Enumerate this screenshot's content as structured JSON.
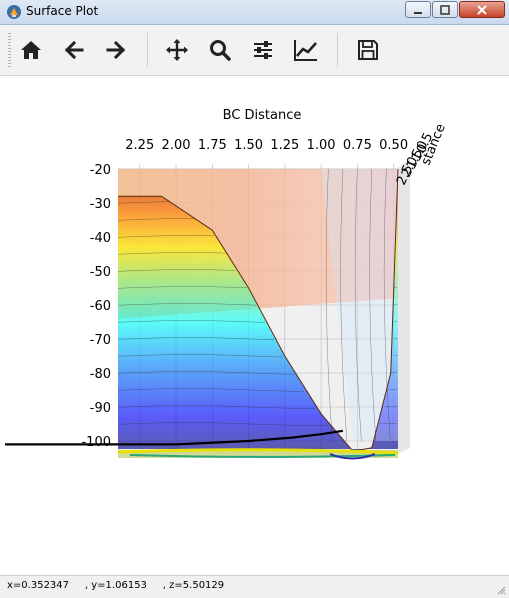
{
  "window": {
    "title": "Surface Plot"
  },
  "toolbar": {
    "buttons": [
      {
        "name": "home-icon",
        "tooltip": "Home"
      },
      {
        "name": "back-arrow-icon",
        "tooltip": "Back"
      },
      {
        "name": "forward-arrow-icon",
        "tooltip": "Forward"
      },
      {
        "name": "pan-icon",
        "tooltip": "Pan"
      },
      {
        "name": "zoom-icon",
        "tooltip": "Zoom"
      },
      {
        "name": "subplots-config-icon",
        "tooltip": "Subplots"
      },
      {
        "name": "axes-edit-icon",
        "tooltip": "Customize"
      },
      {
        "name": "save-icon",
        "tooltip": "Save"
      }
    ]
  },
  "plot": {
    "x_axis_label": "BC Distance",
    "y_axis_label_partial": "stance",
    "x_ticks": [
      "2.25",
      "2.00",
      "1.75",
      "1.50",
      "1.25",
      "1.00",
      "0.75",
      "0.50"
    ],
    "z_ticks": [
      "-20",
      "-30",
      "-40",
      "-50",
      "-60",
      "-70",
      "-80",
      "-90",
      "-100"
    ],
    "y_ticks_partial": [
      "2.5",
      "2.0",
      "1.5",
      "1.0",
      "0.5"
    ],
    "colormap": "jet",
    "alpha": "translucent"
  },
  "chart_data": {
    "type": "surface3d",
    "title": "",
    "xlabel": "BC Distance",
    "xticks": [
      2.25,
      2.0,
      1.75,
      1.5,
      1.25,
      1.0,
      0.75,
      0.5
    ],
    "zticks": [
      -20,
      -30,
      -40,
      -50,
      -60,
      -70,
      -80,
      -90,
      -100
    ],
    "zlim": [
      -100,
      -20
    ],
    "profile_edge_energy": [
      {
        "bc": 2.4,
        "z": -28
      },
      {
        "bc": 2.1,
        "z": -28
      },
      {
        "bc": 1.75,
        "z": -38
      },
      {
        "bc": 1.5,
        "z": -55
      },
      {
        "bc": 1.25,
        "z": -75
      },
      {
        "bc": 1.0,
        "z": -92
      },
      {
        "bc": 0.78,
        "z": -103
      },
      {
        "bc": 0.65,
        "z": -102
      },
      {
        "bc": 0.52,
        "z": -80
      },
      {
        "bc": 0.47,
        "z": -20
      }
    ],
    "trajectory": [
      {
        "bc": 2.4,
        "z": -101
      },
      {
        "bc": 2.0,
        "z": -101
      },
      {
        "bc": 1.5,
        "z": -100
      },
      {
        "bc": 1.2,
        "z": -99
      },
      {
        "bc": 1.0,
        "z": -98
      },
      {
        "bc": 0.85,
        "z": -97
      }
    ]
  },
  "status": {
    "text": "x=0.352347     , y=1.06153     , z=5.50129"
  }
}
